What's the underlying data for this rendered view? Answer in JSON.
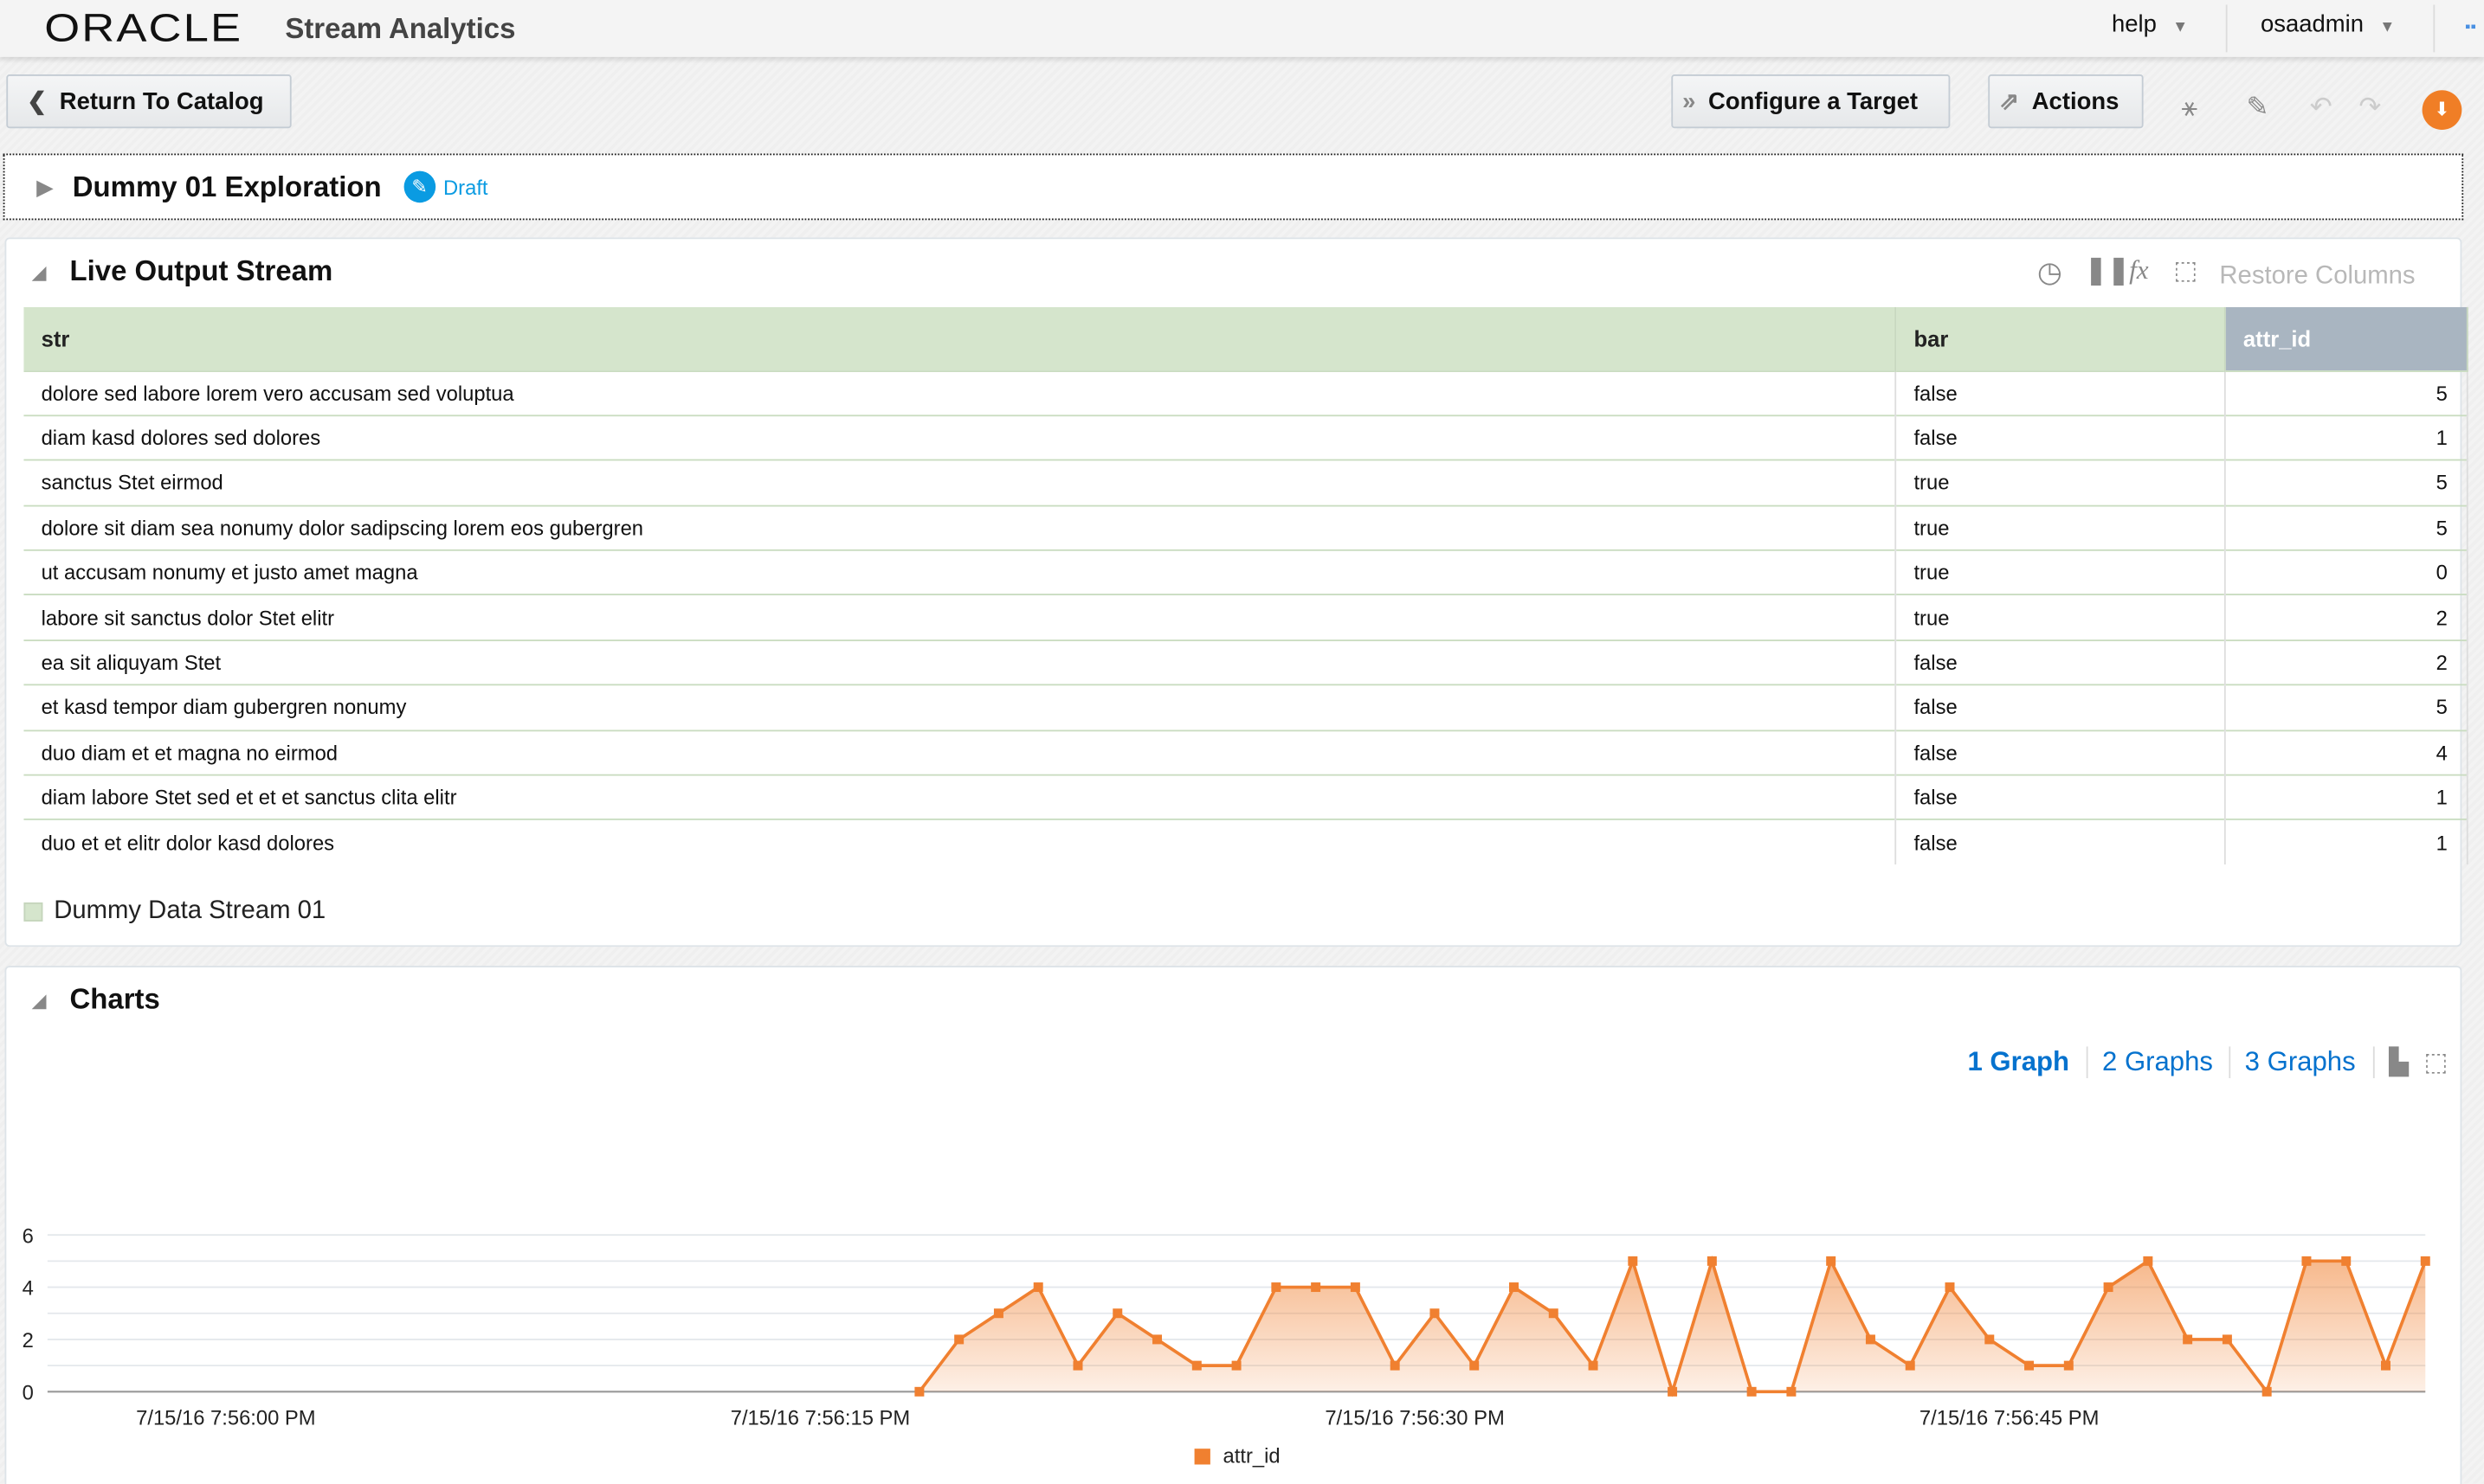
{
  "header": {
    "logo": "ORACLE",
    "app_name": "Stream Analytics",
    "help": "help",
    "user": "osaadmin"
  },
  "toolbar": {
    "return": "Return To Catalog",
    "configure": "Configure a Target",
    "actions": "Actions"
  },
  "exploration": {
    "title": "Dummy 01 Exploration",
    "status": "Draft"
  },
  "live": {
    "title": "Live Output Stream",
    "restore": "Restore Columns",
    "columns": [
      "str",
      "bar",
      "attr_id"
    ],
    "rows": [
      [
        "dolore sed labore lorem vero accusam sed voluptua",
        "false",
        "5"
      ],
      [
        "diam kasd dolores sed dolores",
        "false",
        "1"
      ],
      [
        "sanctus Stet eirmod",
        "true",
        "5"
      ],
      [
        "dolore sit diam sea nonumy dolor sadipscing lorem eos gubergren",
        "true",
        "5"
      ],
      [
        "ut accusam nonumy et justo amet magna",
        "true",
        "0"
      ],
      [
        "labore sit sanctus dolor Stet elitr",
        "true",
        "2"
      ],
      [
        "ea sit aliquyam Stet",
        "false",
        "2"
      ],
      [
        "et kasd tempor diam gubergren nonumy",
        "false",
        "5"
      ],
      [
        "duo diam et et magna no eirmod",
        "false",
        "4"
      ],
      [
        "diam labore Stet sed et et et sanctus clita elitr",
        "false",
        "1"
      ],
      [
        "duo et et elitr dolor kasd dolores",
        "false",
        "1"
      ]
    ],
    "legend": "Dummy Data Stream 01",
    "legend_color": "#d5e5cc"
  },
  "charts": {
    "title": "Charts",
    "links": [
      "1 Graph",
      "2 Graphs",
      "3 Graphs"
    ]
  },
  "chart_data": {
    "type": "area",
    "title": "",
    "xlabel": "",
    "ylabel": "",
    "series": [
      {
        "name": "attr_id",
        "color": "#f08030",
        "x_seconds_after_7_56_00": [
          17.5,
          18.5,
          19.5,
          20.5,
          21.5,
          22.5,
          23.5,
          24.5,
          25.5,
          26.5,
          27.5,
          28.5,
          29.5,
          30.5,
          31.5,
          32.5,
          33.5,
          34.5,
          35.5,
          36.5,
          37.5,
          38.5,
          39.5,
          40.5,
          41.5,
          42.5,
          43.5,
          44.5,
          45.5,
          46.5,
          47.5,
          48.5,
          49.5,
          50.5,
          51.5,
          52.5,
          53.5,
          54.5,
          55.5
        ],
        "values": [
          0,
          2,
          3,
          4,
          1,
          3,
          2,
          1,
          1,
          4,
          4,
          4,
          1,
          3,
          1,
          4,
          3,
          1,
          5,
          0,
          5,
          0,
          0,
          5,
          2,
          1,
          4,
          2,
          1,
          1,
          4,
          5,
          2,
          2,
          0,
          5,
          5,
          1,
          5
        ]
      }
    ],
    "xticks": [
      {
        "s": 0,
        "label": "7/15/16 7:56:00 PM"
      },
      {
        "s": 15,
        "label": "7/15/16 7:56:15 PM"
      },
      {
        "s": 30,
        "label": "7/15/16 7:56:30 PM"
      },
      {
        "s": 45,
        "label": "7/15/16 7:56:45 PM"
      }
    ],
    "yticks": [
      "0",
      "2",
      "4",
      "6"
    ],
    "xlim": [
      -4.5,
      55.5
    ],
    "ylim": [
      0,
      6
    ],
    "grid": true,
    "legend": "bottom-center"
  }
}
